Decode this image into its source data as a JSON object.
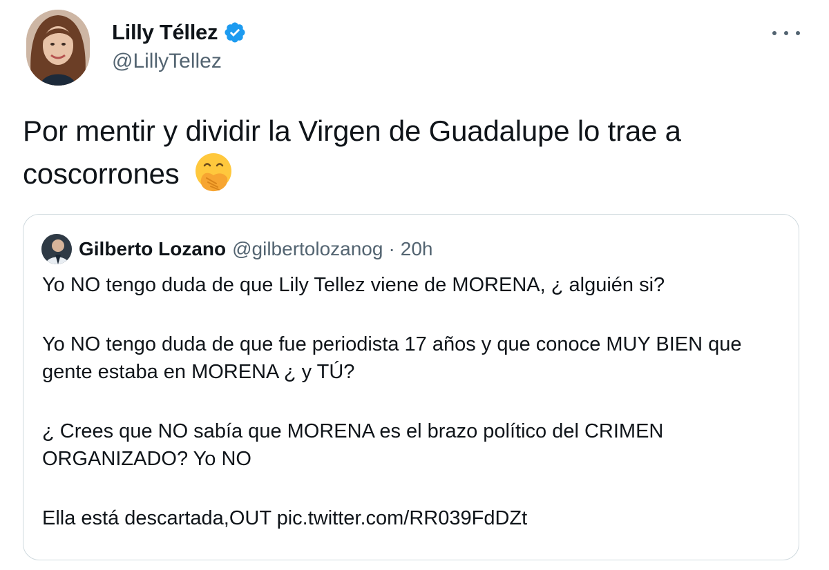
{
  "tweet": {
    "author": {
      "display_name": "Lilly Téllez",
      "handle": "@LillyTellez",
      "verified": true,
      "avatar_icon": "profile-photo"
    },
    "text": "Por mentir y dividir la Virgen de Guadalupe lo trae a coscorrones",
    "emoji": "face-with-hand-over-mouth",
    "more_icon": "more-options-icon"
  },
  "quoted_tweet": {
    "display_name": "Gilberto Lozano",
    "handle": "@gilbertolozanog",
    "separator": "·",
    "time": "20h",
    "paragraphs": [
      "Yo NO tengo duda de que Lily Tellez viene de MORENA, ¿ alguién si?",
      "Yo NO tengo duda de que fue periodista 17 años y que conoce MUY BIEN que gente estaba en MORENA ¿ y TÚ?",
      "¿ Crees que NO sabía que MORENA es el brazo político del CRIMEN ORGANIZADO? Yo NO",
      "Ella está descartada,OUT pic.twitter.com/RR039FdDZt"
    ]
  },
  "colors": {
    "text": "#0f1419",
    "secondary": "#536471",
    "verified": "#1d9bf0",
    "border": "#cfd9de"
  }
}
